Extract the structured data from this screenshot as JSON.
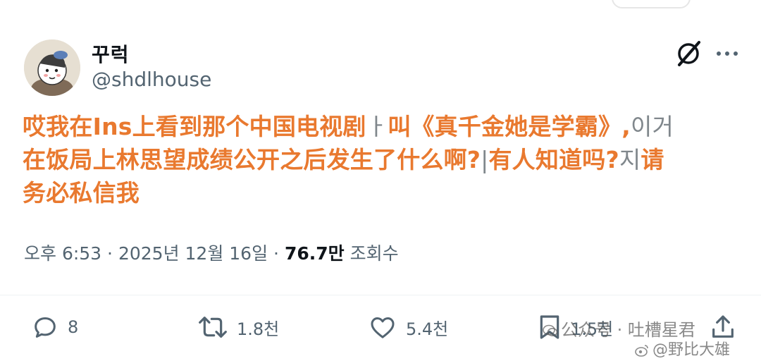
{
  "user": {
    "display_name": "꾸럭",
    "handle": "@shdlhouse",
    "avatar_icon": "cartoon-avatar"
  },
  "header_icons": {
    "grok": "grok-icon",
    "more": "more-icon"
  },
  "tweet": {
    "line1": "哎我在Ins上看到那个中国电视剧",
    "line1_ghost": "ㅏ",
    "line1_b": "叫《真千金她是学霸》",
    "line1_comma": ",",
    "line1_ghost2": "이거",
    "line2": "在饭局上林思望成绩公开之后发生了什么啊?",
    "line2_ghost": "|",
    "line2_b": "有人知道吗?",
    "line2_ghost2": "지",
    "line2_c": "请",
    "line3": "务必私信我",
    "text_color": "#e9792f"
  },
  "meta": {
    "time": "오후 6:53",
    "separator": "·",
    "date": "2025년 12월 16일",
    "views_count": "76.7만",
    "views_label": "조회수"
  },
  "actions": {
    "reply_count": "8",
    "retweet_count": "1.8천",
    "like_count": "5.4천",
    "bookmark_count": "1.5천"
  },
  "watermark": {
    "line1": "公众号 · 吐槽星君",
    "line2": "@野比大雄"
  }
}
